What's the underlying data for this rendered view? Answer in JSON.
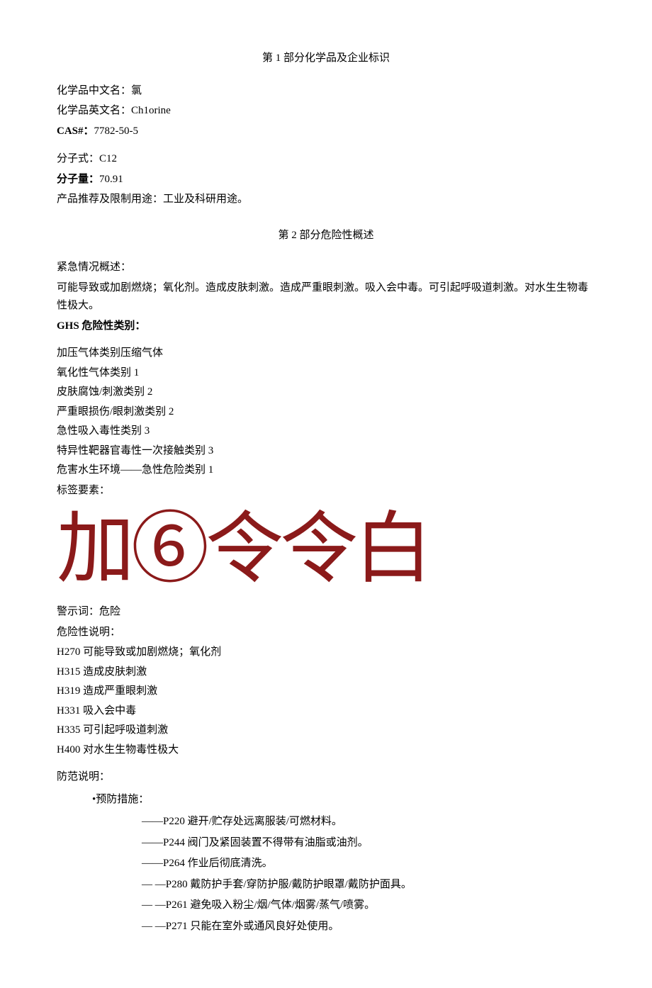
{
  "section1": {
    "title": "第 1 部分化学品及企业标识",
    "fields": {
      "name_cn_label": "化学品中文名：",
      "name_cn_value": "氯",
      "name_en_label": "化学品英文名：",
      "name_en_value": "Ch1orine",
      "cas_label": "CAS#：",
      "cas_value": "7782-50-5",
      "formula_label": "分子式：",
      "formula_value": "C12",
      "mw_label": "分子量：",
      "mw_value": "70.91",
      "uses_label": "产品推荐及限制用途：",
      "uses_value": "工业及科研用途。"
    }
  },
  "section2": {
    "title": "第 2 部分危险性概述",
    "emergency_label": "紧急情况概述：",
    "emergency_text": "可能导致或加剧燃烧；氧化剂。造成皮肤刺激。造成严重眼刺激。吸入会中毒。可引起呼吸道刺激。对水生生物毒性极大。",
    "ghs_label": "GHS 危险性类别：",
    "ghs_categories": [
      "加压气体类别压缩气体",
      "氧化性气体类别 1",
      "皮肤腐蚀/刺激类别 2",
      "严重眼损伤/眼刺激类别 2",
      "急性吸入毒性类别 3",
      "特异性靶器官毒性一次接触类别 3",
      "危害水生环境——急性危险类别 1"
    ],
    "label_elements_label": "标签要素：",
    "pictogram_text": "加⑥令令白",
    "signal_word_label": "警示词：",
    "signal_word_value": "危险",
    "hazard_statements_label": "危险性说明：",
    "hazard_statements": [
      "H270 可能导致或加剧燃烧；氧化剂",
      "H315 造成皮肤刺激",
      "H319 造成严重眼刺激",
      "H331 吸入会中毒",
      "H335 可引起呼吸道刺激",
      "H400 对水生生物毒性极大"
    ],
    "precaution_label": "防范说明：",
    "prevention_bullet": "•预防措施：",
    "precautions": [
      "——P220 避开/贮存处远离服装/可燃材料。",
      "——P244 阀门及紧固装置不得带有油脂或油剂。",
      "——P264 作业后彻底清洗。",
      "—    —P280 戴防护手套/穿防护服/戴防护眼罩/戴防护面具。",
      "—    —P261 避免吸入粉尘/烟/气体/烟雾/蒸气/喷雾。",
      "—    —P271 只能在室外或通风良好处使用。"
    ]
  }
}
